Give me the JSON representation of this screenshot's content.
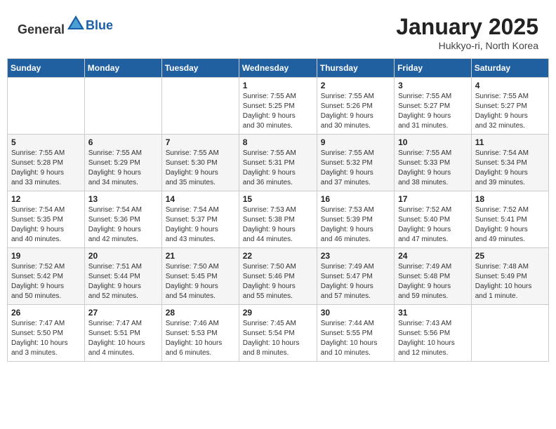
{
  "header": {
    "logo_general": "General",
    "logo_blue": "Blue",
    "title": "January 2025",
    "subtitle": "Hukkyo-ri, North Korea"
  },
  "calendar": {
    "days_of_week": [
      "Sunday",
      "Monday",
      "Tuesday",
      "Wednesday",
      "Thursday",
      "Friday",
      "Saturday"
    ],
    "weeks": [
      [
        {
          "day": "",
          "info": ""
        },
        {
          "day": "",
          "info": ""
        },
        {
          "day": "",
          "info": ""
        },
        {
          "day": "1",
          "info": "Sunrise: 7:55 AM\nSunset: 5:25 PM\nDaylight: 9 hours\nand 30 minutes."
        },
        {
          "day": "2",
          "info": "Sunrise: 7:55 AM\nSunset: 5:26 PM\nDaylight: 9 hours\nand 30 minutes."
        },
        {
          "day": "3",
          "info": "Sunrise: 7:55 AM\nSunset: 5:27 PM\nDaylight: 9 hours\nand 31 minutes."
        },
        {
          "day": "4",
          "info": "Sunrise: 7:55 AM\nSunset: 5:27 PM\nDaylight: 9 hours\nand 32 minutes."
        }
      ],
      [
        {
          "day": "5",
          "info": "Sunrise: 7:55 AM\nSunset: 5:28 PM\nDaylight: 9 hours\nand 33 minutes."
        },
        {
          "day": "6",
          "info": "Sunrise: 7:55 AM\nSunset: 5:29 PM\nDaylight: 9 hours\nand 34 minutes."
        },
        {
          "day": "7",
          "info": "Sunrise: 7:55 AM\nSunset: 5:30 PM\nDaylight: 9 hours\nand 35 minutes."
        },
        {
          "day": "8",
          "info": "Sunrise: 7:55 AM\nSunset: 5:31 PM\nDaylight: 9 hours\nand 36 minutes."
        },
        {
          "day": "9",
          "info": "Sunrise: 7:55 AM\nSunset: 5:32 PM\nDaylight: 9 hours\nand 37 minutes."
        },
        {
          "day": "10",
          "info": "Sunrise: 7:55 AM\nSunset: 5:33 PM\nDaylight: 9 hours\nand 38 minutes."
        },
        {
          "day": "11",
          "info": "Sunrise: 7:54 AM\nSunset: 5:34 PM\nDaylight: 9 hours\nand 39 minutes."
        }
      ],
      [
        {
          "day": "12",
          "info": "Sunrise: 7:54 AM\nSunset: 5:35 PM\nDaylight: 9 hours\nand 40 minutes."
        },
        {
          "day": "13",
          "info": "Sunrise: 7:54 AM\nSunset: 5:36 PM\nDaylight: 9 hours\nand 42 minutes."
        },
        {
          "day": "14",
          "info": "Sunrise: 7:54 AM\nSunset: 5:37 PM\nDaylight: 9 hours\nand 43 minutes."
        },
        {
          "day": "15",
          "info": "Sunrise: 7:53 AM\nSunset: 5:38 PM\nDaylight: 9 hours\nand 44 minutes."
        },
        {
          "day": "16",
          "info": "Sunrise: 7:53 AM\nSunset: 5:39 PM\nDaylight: 9 hours\nand 46 minutes."
        },
        {
          "day": "17",
          "info": "Sunrise: 7:52 AM\nSunset: 5:40 PM\nDaylight: 9 hours\nand 47 minutes."
        },
        {
          "day": "18",
          "info": "Sunrise: 7:52 AM\nSunset: 5:41 PM\nDaylight: 9 hours\nand 49 minutes."
        }
      ],
      [
        {
          "day": "19",
          "info": "Sunrise: 7:52 AM\nSunset: 5:42 PM\nDaylight: 9 hours\nand 50 minutes."
        },
        {
          "day": "20",
          "info": "Sunrise: 7:51 AM\nSunset: 5:44 PM\nDaylight: 9 hours\nand 52 minutes."
        },
        {
          "day": "21",
          "info": "Sunrise: 7:50 AM\nSunset: 5:45 PM\nDaylight: 9 hours\nand 54 minutes."
        },
        {
          "day": "22",
          "info": "Sunrise: 7:50 AM\nSunset: 5:46 PM\nDaylight: 9 hours\nand 55 minutes."
        },
        {
          "day": "23",
          "info": "Sunrise: 7:49 AM\nSunset: 5:47 PM\nDaylight: 9 hours\nand 57 minutes."
        },
        {
          "day": "24",
          "info": "Sunrise: 7:49 AM\nSunset: 5:48 PM\nDaylight: 9 hours\nand 59 minutes."
        },
        {
          "day": "25",
          "info": "Sunrise: 7:48 AM\nSunset: 5:49 PM\nDaylight: 10 hours\nand 1 minute."
        }
      ],
      [
        {
          "day": "26",
          "info": "Sunrise: 7:47 AM\nSunset: 5:50 PM\nDaylight: 10 hours\nand 3 minutes."
        },
        {
          "day": "27",
          "info": "Sunrise: 7:47 AM\nSunset: 5:51 PM\nDaylight: 10 hours\nand 4 minutes."
        },
        {
          "day": "28",
          "info": "Sunrise: 7:46 AM\nSunset: 5:53 PM\nDaylight: 10 hours\nand 6 minutes."
        },
        {
          "day": "29",
          "info": "Sunrise: 7:45 AM\nSunset: 5:54 PM\nDaylight: 10 hours\nand 8 minutes."
        },
        {
          "day": "30",
          "info": "Sunrise: 7:44 AM\nSunset: 5:55 PM\nDaylight: 10 hours\nand 10 minutes."
        },
        {
          "day": "31",
          "info": "Sunrise: 7:43 AM\nSunset: 5:56 PM\nDaylight: 10 hours\nand 12 minutes."
        },
        {
          "day": "",
          "info": ""
        }
      ]
    ]
  }
}
